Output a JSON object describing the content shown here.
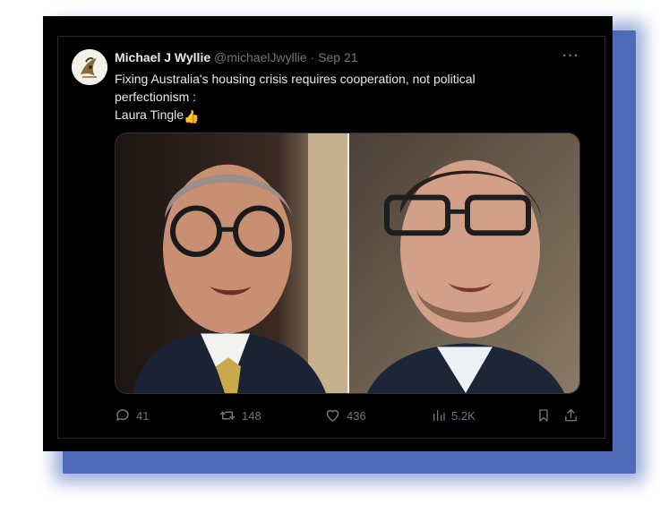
{
  "tweet": {
    "author_name": "Michael J Wyllie",
    "handle": "@michaelJwyllie",
    "separator": "·",
    "date": "Sep 21",
    "more_label": "···",
    "text_lines": [
      "Fixing Australia's housing crisis requires cooperation, not political",
      "perfectionism :",
      "Laura Tingle"
    ],
    "thumb_emoji": "👍"
  },
  "actions": {
    "replies": "41",
    "reposts": "148",
    "likes": "436",
    "views": "5.2K"
  },
  "colors": {
    "background": "#000000",
    "text": "#e7e9ea",
    "muted": "#71767b",
    "frame_shadow": "#4f6bb8"
  },
  "icons": {
    "reply": "reply-icon",
    "repost": "repost-icon",
    "like": "like-icon",
    "views": "views-icon",
    "bookmark": "bookmark-icon",
    "share": "share-icon"
  }
}
